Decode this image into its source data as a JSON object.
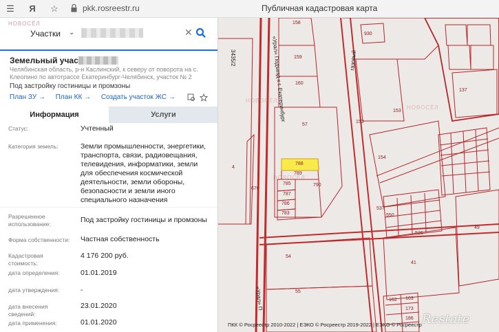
{
  "browser": {
    "url": "pkk.rosreestr.ru",
    "title": "Публичная кадастровая карта"
  },
  "search": {
    "category": "Участки",
    "watermark": "НОВОСЁЛ"
  },
  "object": {
    "title": "Земельный участок",
    "address": "Челябинская область, р-н Каслинский, к северу от поворота на с. Клеопино по автотрассе Екатеринбург-Челябинск, участок № 2",
    "usage": "Под застройку гостиницы и промзоны",
    "links": [
      "План ЗУ →",
      "План КК →",
      "Создать участок ЖС →"
    ]
  },
  "tabs": [
    "Информация",
    "Услуги"
  ],
  "rows": [
    {
      "label": "Статус:",
      "value": "Учтенный"
    },
    {
      "label": "Категория земель:",
      "value": "Земли промышленности, энергетики, транспорта, связи, радиовещания, телевидения, информатики, земли для обеспечения космической деятельности, земли обороны, безопасности и земли иного специального назначения"
    },
    {
      "label": "Разрешенное использование:",
      "value": "Под застройку гостиницы и промзоны"
    },
    {
      "label": "Форма собственности:",
      "value": "Частная собственность"
    },
    {
      "label": "Кадастровая стоимость:",
      "value": "4 176 200 руб."
    },
    {
      "label": "дата определения:",
      "value": "01.01.2019"
    },
    {
      "label": "дата утверждения:",
      "value": "-"
    },
    {
      "label": "дата внесения сведений:",
      "value": "23.01.2020"
    },
    {
      "label": "дата применения:",
      "value": "01.01.2020"
    }
  ],
  "map": {
    "parcels": [
      {
        "id": "158",
        "label": "158"
      },
      {
        "id": "159",
        "label": "159"
      },
      {
        "id": "160",
        "label": "160"
      },
      {
        "id": "57",
        "label": "57"
      },
      {
        "id": "153",
        "label": "153"
      },
      {
        "id": "153b",
        "label": "153"
      },
      {
        "id": "154",
        "label": "154"
      },
      {
        "id": "4",
        "label": "4"
      },
      {
        "id": "676",
        "label": "676"
      },
      {
        "id": "788",
        "label": "788"
      },
      {
        "id": "789",
        "label": "789"
      },
      {
        "id": "785",
        "label": "785"
      },
      {
        "id": "787",
        "label": "787"
      },
      {
        "id": "790",
        "label": "790"
      },
      {
        "id": "786",
        "label": "786"
      },
      {
        "id": "783",
        "label": "783"
      },
      {
        "id": "54",
        "label": "54"
      },
      {
        "id": "55",
        "label": "55"
      },
      {
        "id": "41",
        "label": "41"
      },
      {
        "id": "49",
        "label": "49"
      },
      {
        "id": "137",
        "label": "137"
      },
      {
        "id": "930",
        "label": "930"
      },
      {
        "id": "537",
        "label": "537"
      },
      {
        "id": "550",
        "label": "550"
      },
      {
        "id": "526",
        "label": "526"
      },
      {
        "id": "162",
        "label": "162"
      },
      {
        "id": "163",
        "label": "163"
      },
      {
        "id": "173",
        "label": "173"
      },
      {
        "id": "186",
        "label": "186"
      },
      {
        "id": "3435_2",
        "label": "3435/2"
      }
    ],
    "road_label_1": "«Урал» Подъезд к г. Екатеринбург",
    "road_label_2": "«Урал» П",
    "side_label": "газовый",
    "copyright": "ПКК © Росреестр 2010-2022 | ЕЭКО © Росреестр 2019-2022 | ЕЭКО © Росреестр",
    "brand": "Restate",
    "colors": {
      "parcel": "#b5262b",
      "highlight": "#f7ea4a",
      "road": "#c02b2b"
    }
  }
}
